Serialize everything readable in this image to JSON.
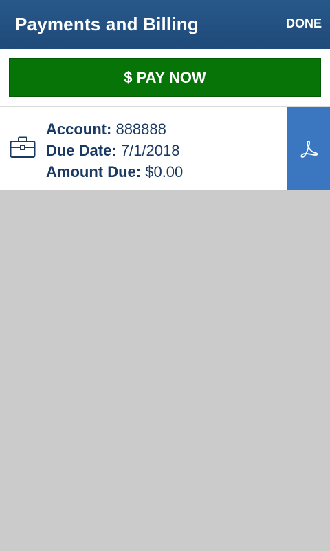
{
  "header": {
    "title": "Payments and Billing",
    "done_label": "DONE"
  },
  "pay_button": {
    "label": "$ PAY NOW"
  },
  "account": {
    "account_label": "Account:",
    "account_value": "888888",
    "due_date_label": "Due Date:",
    "due_date_value": "7/1/2018",
    "amount_due_label": "Amount Due:",
    "amount_due_value": "$0.00"
  },
  "icons": {
    "account": "briefcase-icon",
    "statement": "pdf-icon"
  },
  "colors": {
    "header": "#1f4a79",
    "pay_button": "#077407",
    "pdf_button": "#3a77c0",
    "text": "#1b3a63",
    "background": "#cbcbcb"
  }
}
